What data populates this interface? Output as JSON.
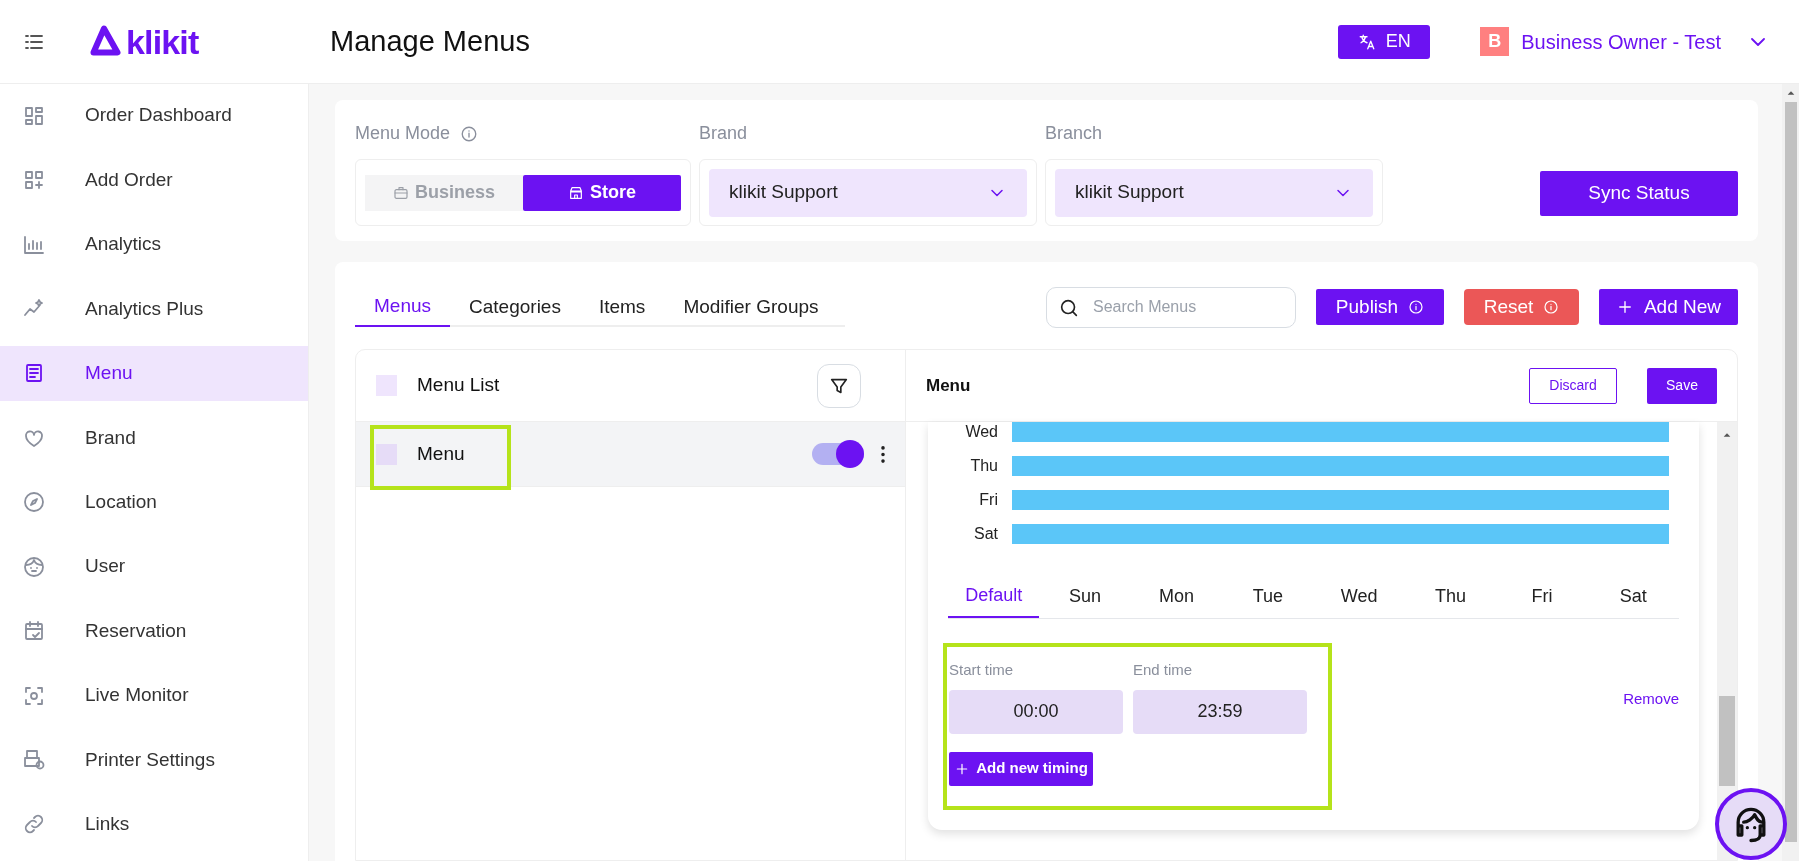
{
  "header": {
    "logo": "klikit",
    "title": "Manage Menus",
    "language": "EN",
    "account": {
      "initial": "B",
      "name": "Business Owner - Test"
    }
  },
  "sidebar": {
    "items": [
      {
        "label": "Order Dashboard",
        "selected": false
      },
      {
        "label": "Add Order",
        "selected": false
      },
      {
        "label": "Analytics",
        "selected": false
      },
      {
        "label": "Analytics Plus",
        "selected": false
      },
      {
        "label": "Menu",
        "selected": true
      },
      {
        "label": "Brand",
        "selected": false
      },
      {
        "label": "Location",
        "selected": false
      },
      {
        "label": "User",
        "selected": false
      },
      {
        "label": "Reservation",
        "selected": false
      },
      {
        "label": "Live Monitor",
        "selected": false
      },
      {
        "label": "Printer Settings",
        "selected": false
      },
      {
        "label": "Links",
        "selected": false
      }
    ]
  },
  "filters": {
    "menu_mode": {
      "label": "Menu Mode",
      "options": [
        {
          "label": "Business",
          "selected": false
        },
        {
          "label": "Store",
          "selected": true
        }
      ]
    },
    "brand": {
      "label": "Brand",
      "value": "klikit Support"
    },
    "branch": {
      "label": "Branch",
      "value": "klikit Support"
    },
    "sync_button": "Sync Status"
  },
  "tabs": [
    {
      "label": "Menus",
      "selected": true
    },
    {
      "label": "Categories",
      "selected": false
    },
    {
      "label": "Items",
      "selected": false
    },
    {
      "label": "Modifier Groups",
      "selected": false
    }
  ],
  "search": {
    "placeholder": "Search Menus"
  },
  "actions": {
    "publish": "Publish",
    "reset": "Reset",
    "add_new": "Add New"
  },
  "menu_list": {
    "title": "Menu List",
    "checked": false,
    "rows": [
      {
        "name": "Menu",
        "checked": false,
        "selected": true,
        "on": true
      }
    ]
  },
  "editor": {
    "title": "Menu",
    "discard": "Discard",
    "save": "Save",
    "schedule_rows": [
      {
        "day": "Wed"
      },
      {
        "day": "Thu"
      },
      {
        "day": "Fri"
      },
      {
        "day": "Sat"
      }
    ],
    "day_tabs": [
      {
        "label": "Default",
        "selected": true
      },
      {
        "label": "Sun",
        "selected": false
      },
      {
        "label": "Mon",
        "selected": false
      },
      {
        "label": "Tue",
        "selected": false
      },
      {
        "label": "Wed",
        "selected": false
      },
      {
        "label": "Thu",
        "selected": false
      },
      {
        "label": "Fri",
        "selected": false
      },
      {
        "label": "Sat",
        "selected": false
      }
    ],
    "timing": {
      "start_label": "Start time",
      "start": "00:00",
      "end_label": "End time",
      "end": "23:59",
      "remove": "Remove",
      "add": "Add new timing"
    }
  }
}
